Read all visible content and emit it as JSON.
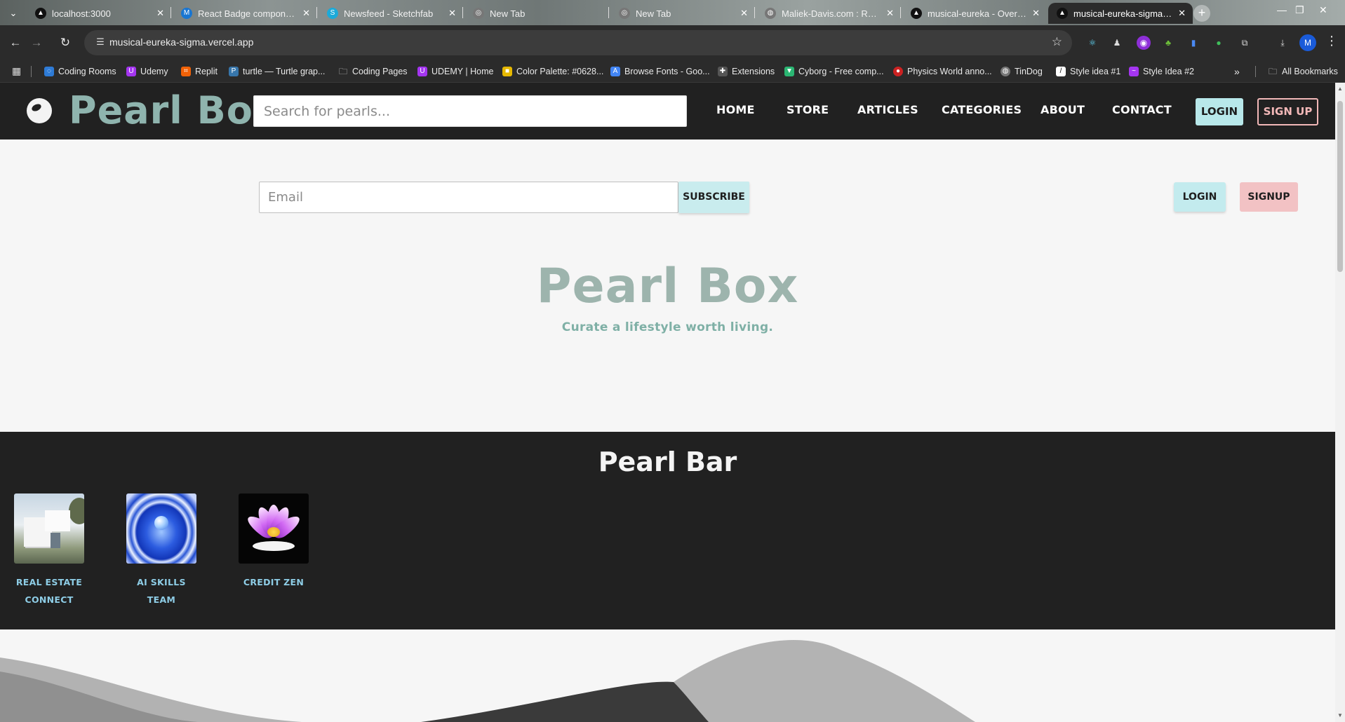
{
  "browser": {
    "tabs": [
      {
        "title": "localhost:3000",
        "favicon": "triangle-icon",
        "color": "#111111",
        "active": false
      },
      {
        "title": "React Badge component",
        "favicon": "mui-icon",
        "color": "#1976d2",
        "active": false
      },
      {
        "title": "Newsfeed - Sketchfab",
        "favicon": "sketchfab-icon",
        "color": "#1caad9",
        "active": false
      },
      {
        "title": "New Tab",
        "favicon": "chrome-icon",
        "color": "#888888",
        "active": false
      },
      {
        "title": "New Tab",
        "favicon": "chrome-icon",
        "color": "#888888",
        "active": false
      },
      {
        "title": "Maliek-Davis.com : Rebra",
        "favicon": "globe-icon",
        "color": "#888888",
        "active": false
      },
      {
        "title": "musical-eureka - Overvie",
        "favicon": "triangle-icon",
        "color": "#111111",
        "active": false
      },
      {
        "title": "musical-eureka-sigma.ver",
        "favicon": "triangle-icon",
        "color": "#111111",
        "active": true
      }
    ],
    "url": "musical-eureka-sigma.vercel.app",
    "bookmarks": [
      {
        "label": "Coding Rooms",
        "icon": "coding-rooms-icon",
        "color": "#2e7bd6"
      },
      {
        "label": "Udemy",
        "icon": "udemy-icon",
        "color": "#a435f0"
      },
      {
        "label": "Replit",
        "icon": "replit-icon",
        "color": "#f26207"
      },
      {
        "label": "turtle — Turtle grap...",
        "icon": "python-icon",
        "color": "#3776ab"
      },
      {
        "label": "Coding Pages",
        "icon": "folder-icon",
        "color": "#555555"
      },
      {
        "label": "UDEMY | Home",
        "icon": "udemy-icon",
        "color": "#a435f0"
      },
      {
        "label": "Color Palette: #0628...",
        "icon": "palette-icon",
        "color": "#e6b800"
      },
      {
        "label": "Browse Fonts - Goo...",
        "icon": "google-fonts-icon",
        "color": "#4285f4"
      },
      {
        "label": "Extensions",
        "icon": "puzzle-icon",
        "color": "#666666"
      },
      {
        "label": "Cyborg - Free comp...",
        "icon": "cyborg-icon",
        "color": "#2bb673"
      },
      {
        "label": "Physics World anno...",
        "icon": "physics-world-icon",
        "color": "#cc2222"
      },
      {
        "label": "TinDog",
        "icon": "globe-icon",
        "color": "#777777"
      },
      {
        "label": "Style idea #1",
        "icon": "style-icon",
        "color": "#ffffff"
      },
      {
        "label": "Style Idea #2",
        "icon": "style-icon",
        "color": "#a435f0"
      }
    ],
    "all_bookmarks_label": "All Bookmarks"
  },
  "header": {
    "brand": "Pearl Box",
    "search_placeholder": "Search for pearls...",
    "nav": [
      "HOME",
      "STORE",
      "ARTICLES",
      "CATEGORIES",
      "ABOUT",
      "CONTACT"
    ],
    "login": "LOGIN",
    "signup": "SIGN UP"
  },
  "hero": {
    "email_placeholder": "Email",
    "subscribe": "SUBSCRIBE",
    "login": "LOGIN",
    "signup": "SIGNUP",
    "title": "Pearl Box",
    "subtitle": "Curate a lifestyle worth living."
  },
  "pearl_bar": {
    "title": "Pearl Bar",
    "items": [
      {
        "label": "REAL ESTATE CONNECT",
        "image": "modern-house-image"
      },
      {
        "label": "AI SKILLS TEAM",
        "image": "blue-pearl-image"
      },
      {
        "label": "CREDIT ZEN",
        "image": "lotus-flower-image"
      }
    ]
  },
  "colors": {
    "header_bg": "#212121",
    "brand": "#8fb4ae",
    "login_btn": "#b8e8ea",
    "signup_accent": "#f2b8b8",
    "pearl_label": "#8ecde6"
  }
}
